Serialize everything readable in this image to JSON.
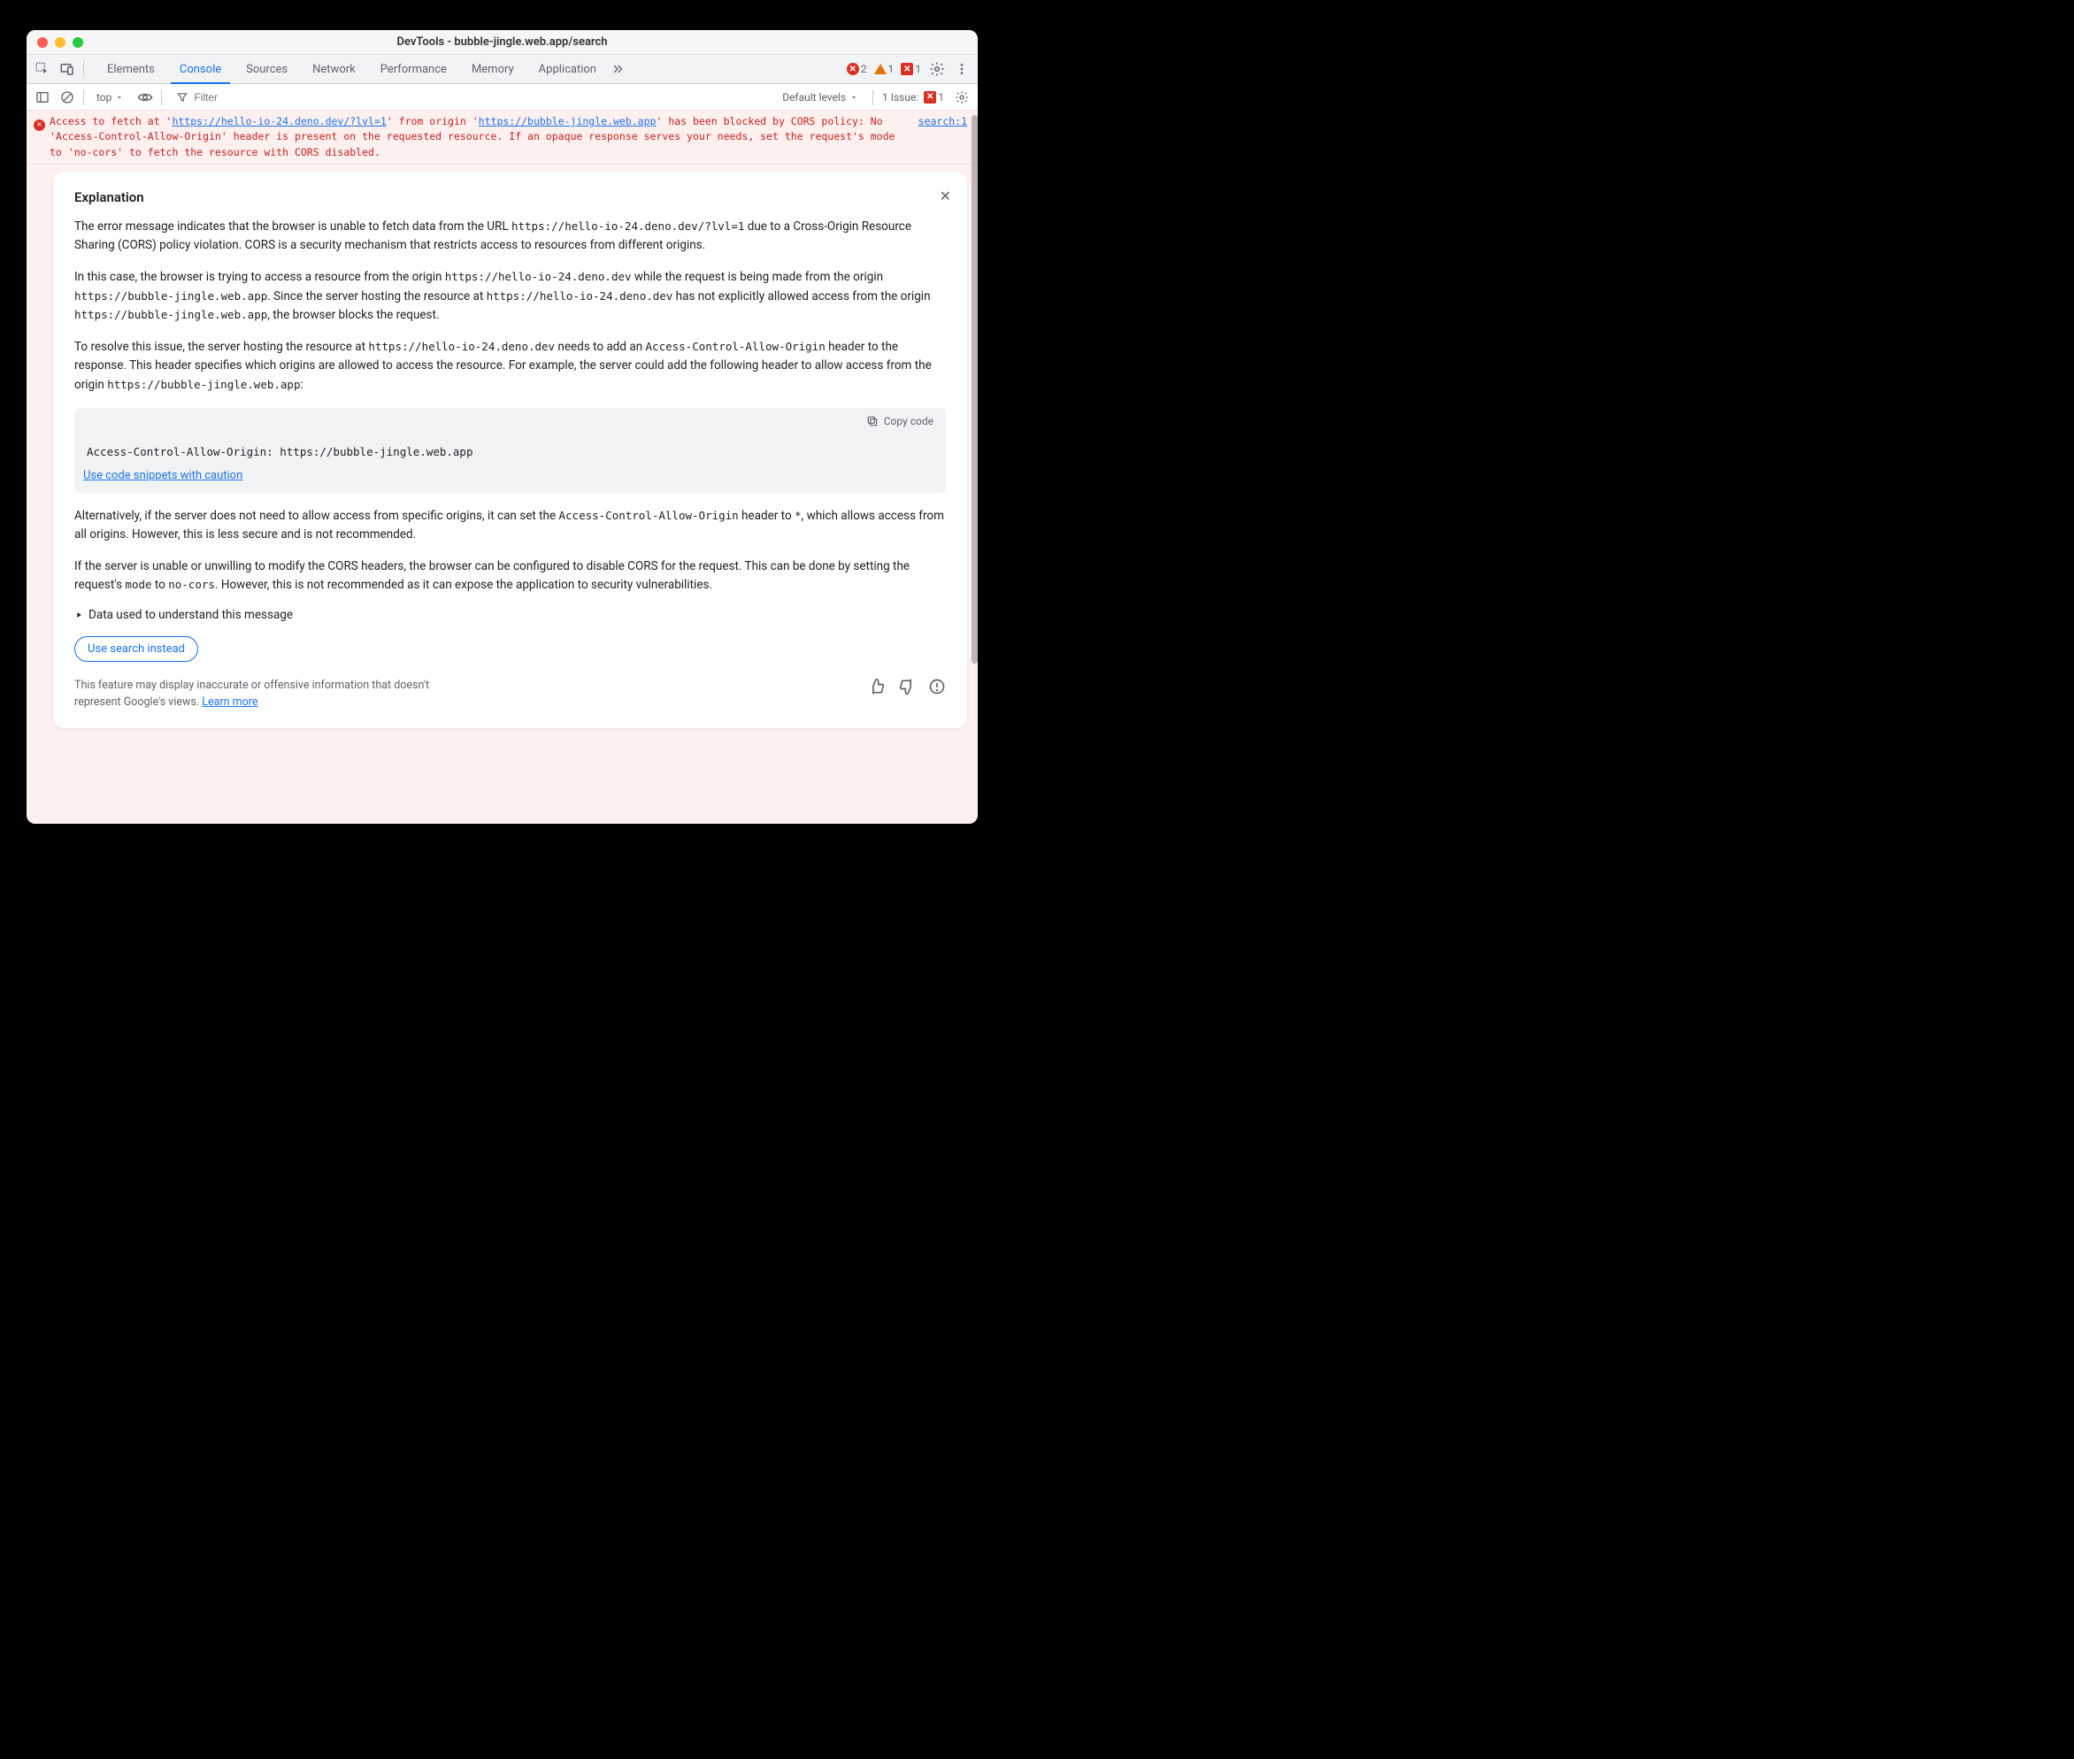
{
  "window": {
    "title": "DevTools - bubble-jingle.web.app/search"
  },
  "tabs": {
    "items": [
      "Elements",
      "Console",
      "Sources",
      "Network",
      "Performance",
      "Memory",
      "Application"
    ],
    "active": "Console"
  },
  "badges": {
    "errors": "2",
    "warnings": "1",
    "issues_tab": "1"
  },
  "toolbar": {
    "context": "top",
    "filter_placeholder": "Filter",
    "default_levels": "Default levels",
    "issue_label": "1 Issue:",
    "issue_count": "1"
  },
  "error": {
    "pre1": "Access to fetch at '",
    "url1": "https://hello-io-24.deno.dev/?lvl=1",
    "mid1": "' from origin '",
    "url2": "https://bubble-jingle.web.app",
    "post1": "' has been blocked by CORS policy: No 'Access-Control-Allow-Origin' header is present on the requested resource. If an opaque response serves your needs, set the request's mode to 'no-cors' to fetch the resource with CORS disabled.",
    "source": "search:1"
  },
  "explanation": {
    "title": "Explanation",
    "p1a": "The error message indicates that the browser is unable to fetch data from the URL ",
    "p1url": "https://hello-io-24.deno.dev/?lvl=1",
    "p1b": " due to a Cross-Origin Resource Sharing (CORS) policy violation. CORS is a security mechanism that restricts access to resources from different origins.",
    "p2a": "In this case, the browser is trying to access a resource from the origin ",
    "p2u1": "https://hello-io-24.deno.dev",
    "p2b": " while the request is being made from the origin ",
    "p2u2": "https://bubble-jingle.web.app",
    "p2c": ". Since the server hosting the resource at ",
    "p2u3": "https://hello-io-24.deno.dev",
    "p2d": " has not explicitly allowed access from the origin ",
    "p2u4": "https://bubble-jingle.web.app",
    "p2e": ", the browser blocks the request.",
    "p3a": "To resolve this issue, the server hosting the resource at ",
    "p3u1": "https://hello-io-24.deno.dev",
    "p3b": " needs to add an ",
    "p3h": "Access-Control-Allow-Origin",
    "p3c": " header to the response. This header specifies which origins are allowed to access the resource. For example, the server could add the following header to allow access from the origin ",
    "p3u2": "https://bubble-jingle.web.app",
    "p3d": ":",
    "copy_label": "Copy code",
    "code": "Access-Control-Allow-Origin: https://bubble-jingle.web.app",
    "caution": "Use code snippets with caution",
    "p4a": "Alternatively, if the server does not need to allow access from specific origins, it can set the ",
    "p4h": "Access-Control-Allow-Origin",
    "p4b": " header to ",
    "p4star": "*",
    "p4c": ", which allows access from all origins. However, this is less secure and is not recommended.",
    "p5a": "If the server is unable or unwilling to modify the CORS headers, the browser can be configured to disable CORS for the request. This can be done by setting the request's ",
    "p5m": "mode",
    "p5b": " to ",
    "p5nc": "no-cors",
    "p5c": ". However, this is not recommended as it can expose the application to security vulnerabilities.",
    "details_label": "Data used to understand this message",
    "search_btn": "Use search instead",
    "disclaimer": "This feature may display inaccurate or offensive information that doesn't represent Google's views. ",
    "learn_more": "Learn more"
  }
}
